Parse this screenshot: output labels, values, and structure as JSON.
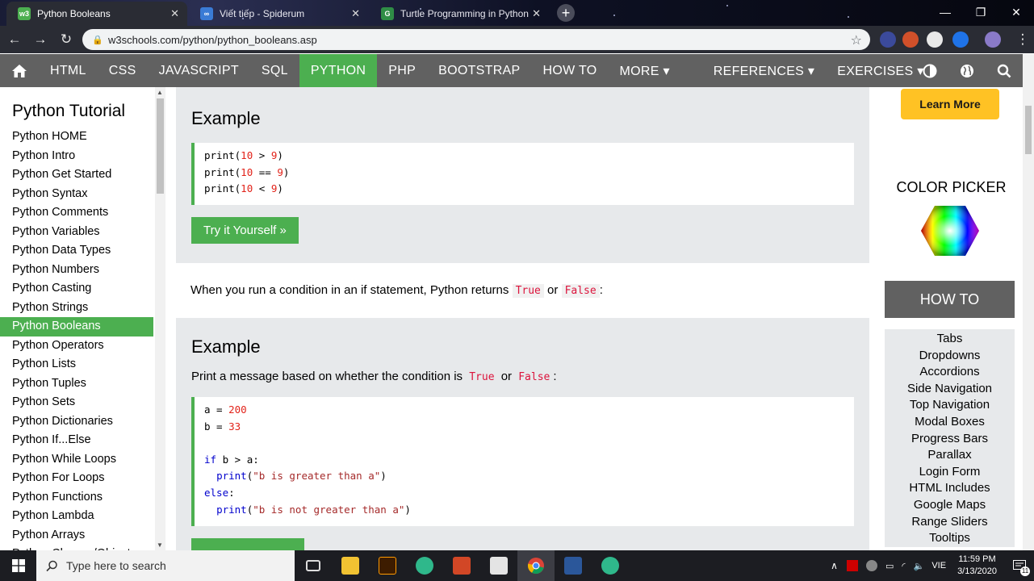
{
  "browser": {
    "tabs": [
      {
        "title": "Python Booleans",
        "favicon": "w3-icon",
        "active": true
      },
      {
        "title": "Viết tiếp - Spiderum",
        "favicon": "spiderum-icon",
        "active": false
      },
      {
        "title": "Turtle Programming in Python",
        "favicon": "gfg-icon",
        "active": false
      }
    ],
    "url": "w3schools.com/python/python_booleans.asp"
  },
  "topnav": {
    "items": [
      "HTML",
      "CSS",
      "JAVASCRIPT",
      "SQL",
      "PYTHON",
      "PHP",
      "BOOTSTRAP",
      "HOW TO",
      "MORE ▾",
      "REFERENCES ▾",
      "EXERCISES ▾"
    ],
    "active": "PYTHON"
  },
  "sidebar": {
    "title": "Python Tutorial",
    "items": [
      "Python HOME",
      "Python Intro",
      "Python Get Started",
      "Python Syntax",
      "Python Comments",
      "Python Variables",
      "Python Data Types",
      "Python Numbers",
      "Python Casting",
      "Python Strings",
      "Python Booleans",
      "Python Operators",
      "Python Lists",
      "Python Tuples",
      "Python Sets",
      "Python Dictionaries",
      "Python If...Else",
      "Python While Loops",
      "Python For Loops",
      "Python Functions",
      "Python Lambda",
      "Python Arrays",
      "Python Classes/Objects"
    ],
    "active": "Python Booleans"
  },
  "main": {
    "example1": {
      "heading": "Example",
      "try_label": "Try it Yourself »"
    },
    "para1": {
      "before": "When you run a condition in an if statement, Python returns",
      "code1": "True",
      "mid": "or",
      "code2": "False",
      "after": ":"
    },
    "example2": {
      "heading": "Example",
      "desc_before": "Print a message based on whether the condition is",
      "code1": "True",
      "mid": "or",
      "code2": "False",
      "after": ":"
    }
  },
  "right": {
    "learn_more": "Learn More",
    "color_picker": "COLOR PICKER",
    "howto_title": "HOW TO",
    "howto_links": [
      "Tabs",
      "Dropdowns",
      "Accordions",
      "Side Navigation",
      "Top Navigation",
      "Modal Boxes",
      "Progress Bars",
      "Parallax",
      "Login Form",
      "HTML Includes",
      "Google Maps",
      "Range Sliders",
      "Tooltips"
    ]
  },
  "taskbar": {
    "search_placeholder": "Type here to search",
    "lang": "VIE",
    "time": "11:59 PM",
    "date": "3/13/2020",
    "notifications": "11"
  },
  "colors": {
    "accent": "#4caf50",
    "nav": "#616161",
    "panel": "#e7e9eb",
    "learn_more": "#ffc224"
  }
}
